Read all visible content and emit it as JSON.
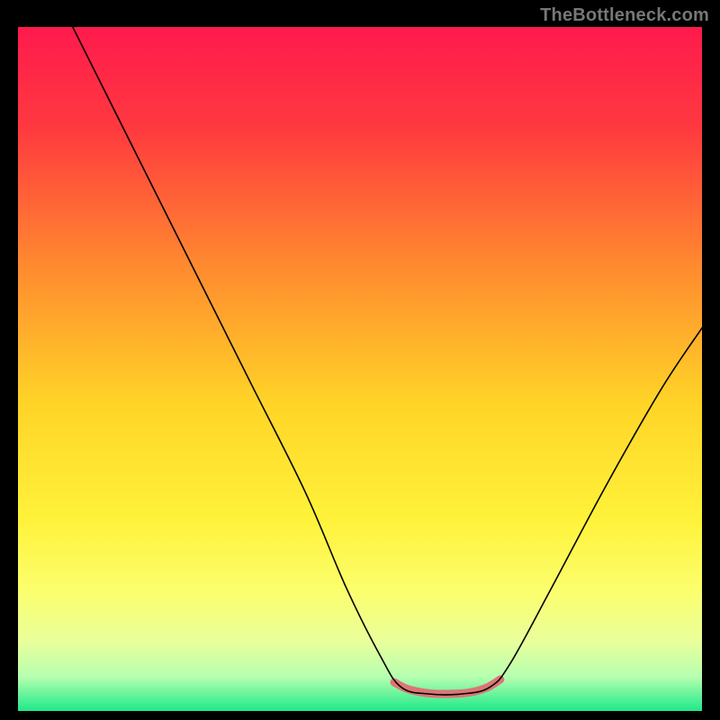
{
  "watermark": "TheBottleneck.com",
  "chart_data": {
    "type": "line",
    "title": "",
    "xlabel": "",
    "ylabel": "",
    "xlim": [
      0,
      100
    ],
    "ylim": [
      0,
      100
    ],
    "background_gradient": {
      "stops": [
        {
          "offset": 0,
          "color": "#ff1a4d"
        },
        {
          "offset": 15,
          "color": "#ff3a3f"
        },
        {
          "offset": 35,
          "color": "#ff8a2f"
        },
        {
          "offset": 55,
          "color": "#ffd427"
        },
        {
          "offset": 72,
          "color": "#fff23a"
        },
        {
          "offset": 83,
          "color": "#fbff70"
        },
        {
          "offset": 90,
          "color": "#e8ff9c"
        },
        {
          "offset": 95,
          "color": "#b6ffb0"
        },
        {
          "offset": 100,
          "color": "#1ee98a"
        }
      ]
    },
    "series": [
      {
        "name": "bottleneck-curve",
        "stroke": "#000000",
        "stroke_width": 1.6,
        "points": [
          {
            "x": 8,
            "y": 100
          },
          {
            "x": 12,
            "y": 92
          },
          {
            "x": 18,
            "y": 80
          },
          {
            "x": 26,
            "y": 64
          },
          {
            "x": 34,
            "y": 48
          },
          {
            "x": 42,
            "y": 32
          },
          {
            "x": 48,
            "y": 18
          },
          {
            "x": 53,
            "y": 8
          },
          {
            "x": 56,
            "y": 3.5
          },
          {
            "x": 60,
            "y": 2.5
          },
          {
            "x": 65,
            "y": 2.5
          },
          {
            "x": 69,
            "y": 3.5
          },
          {
            "x": 72,
            "y": 7
          },
          {
            "x": 78,
            "y": 18
          },
          {
            "x": 86,
            "y": 33
          },
          {
            "x": 94,
            "y": 47
          },
          {
            "x": 100,
            "y": 56
          }
        ]
      },
      {
        "name": "bottom-highlight",
        "stroke": "#dd7576",
        "stroke_width": 9,
        "points": [
          {
            "x": 55,
            "y": 4.2
          },
          {
            "x": 57,
            "y": 3.2
          },
          {
            "x": 60,
            "y": 2.6
          },
          {
            "x": 63,
            "y": 2.5
          },
          {
            "x": 66,
            "y": 2.7
          },
          {
            "x": 68.5,
            "y": 3.4
          },
          {
            "x": 70.5,
            "y": 4.6
          }
        ]
      }
    ]
  }
}
